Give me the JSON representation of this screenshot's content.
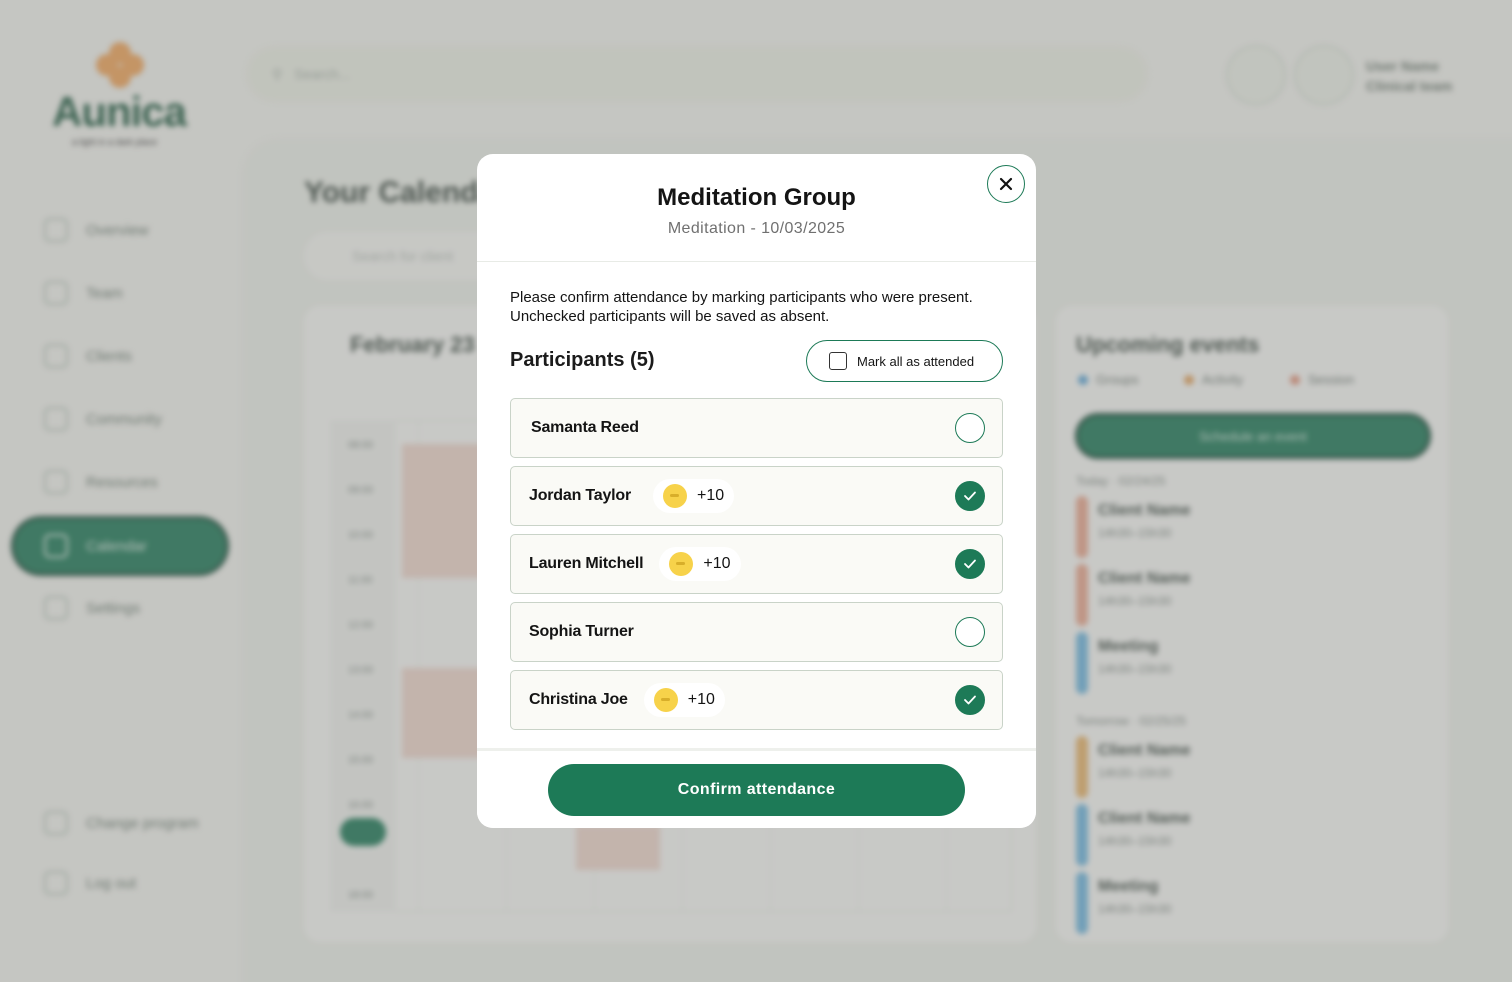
{
  "app": {
    "brand": "Aunica",
    "tagline": "a light in a dark place",
    "search_placeholder": "Search...",
    "user_name": "User Name",
    "user_role": "Clinical team"
  },
  "sidebar": {
    "items": [
      {
        "label": "Overview"
      },
      {
        "label": "Team"
      },
      {
        "label": "Clients"
      },
      {
        "label": "Community"
      },
      {
        "label": "Resources"
      },
      {
        "label": "Calendar"
      },
      {
        "label": "Settings"
      }
    ],
    "footer": [
      {
        "label": "Change program"
      },
      {
        "label": "Log out"
      }
    ]
  },
  "calendar": {
    "title": "Your Calendar",
    "search_placeholder": "Search for client",
    "month": "February 23",
    "times": [
      "08:00",
      "09:00",
      "10:00",
      "11:00",
      "12:00",
      "13:00",
      "14:00",
      "15:00",
      "16:00",
      "17:00",
      "18:00"
    ],
    "now_label": "17:30"
  },
  "upcoming": {
    "title": "Upcoming events",
    "legend": [
      {
        "label": "Groups",
        "color": "#5aa6d6"
      },
      {
        "label": "Activity",
        "color": "#e4a25a"
      },
      {
        "label": "Session",
        "color": "#e4957a"
      }
    ],
    "schedule_label": "Schedule an event",
    "today_label": "Today · 02/24/25",
    "tomorrow_label": "Tomorrow · 02/25/25",
    "events": [
      {
        "name": "Client Name",
        "time": "14h30–15h30",
        "color": "#eba88e"
      },
      {
        "name": "Client Name",
        "time": "14h30–15h30",
        "color": "#eba88e"
      },
      {
        "name": "Meeting",
        "time": "14h30–15h30",
        "color": "#6fb8df"
      },
      {
        "name": "Client Name",
        "time": "14h30–15h30",
        "color": "#e9b56a"
      },
      {
        "name": "Client Name",
        "time": "14h30–15h30",
        "color": "#6fb8df"
      },
      {
        "name": "Meeting",
        "time": "14h30–15h30",
        "color": "#6fb8df"
      }
    ]
  },
  "modal": {
    "title": "Meditation Group",
    "subtitle": "Meditation - 10/03/2025",
    "description": "Please confirm attendance by marking participants who were present. Unchecked participants will be saved as absent.",
    "participants_heading": "Participants (5)",
    "mark_all_label": "Mark all as attended",
    "participants": [
      {
        "name": "Samanta Reed",
        "badge": "",
        "checked": false
      },
      {
        "name": "Jordan Taylor",
        "badge": "+10",
        "checked": true
      },
      {
        "name": "Lauren Mitchell",
        "badge": "+10",
        "checked": true
      },
      {
        "name": "Sophia Turner",
        "badge": "",
        "checked": false
      },
      {
        "name": "Christina Joe",
        "badge": "+10",
        "checked": true
      }
    ],
    "confirm_label": "Confirm attendance",
    "accent": "#1d7a57"
  }
}
